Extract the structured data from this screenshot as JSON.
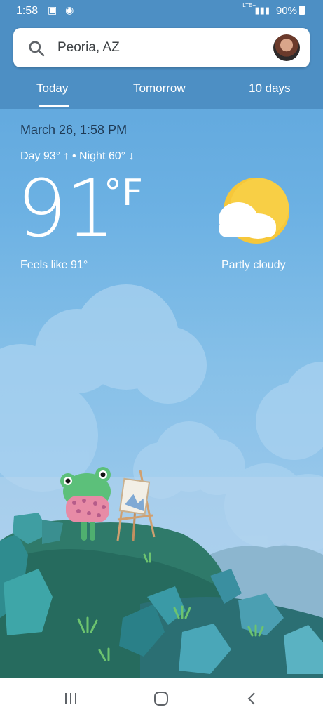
{
  "status_bar": {
    "time": "1:58",
    "network": "LTE+",
    "battery": "90%"
  },
  "search": {
    "location": "Peoria, AZ"
  },
  "tabs": [
    {
      "label": "Today",
      "active": true
    },
    {
      "label": "Tomorrow",
      "active": false
    },
    {
      "label": "10 days",
      "active": false
    }
  ],
  "weather": {
    "date_time": "March 26, 1:58 PM",
    "day_night": "Day 93° ↑ • Night 60° ↓",
    "temperature": "91",
    "unit": "°F",
    "feels_like": "Feels like 91°",
    "condition": "Partly cloudy",
    "condition_icon": "partly-cloudy-icon"
  },
  "nav_bar": {
    "buttons": [
      "recents-icon",
      "home-icon",
      "back-icon"
    ]
  },
  "colors": {
    "header_bg": "#4d8fc4",
    "sky_top": "#5aa2da",
    "sun": "#f6c73a",
    "date_text": "#1f3a55"
  }
}
